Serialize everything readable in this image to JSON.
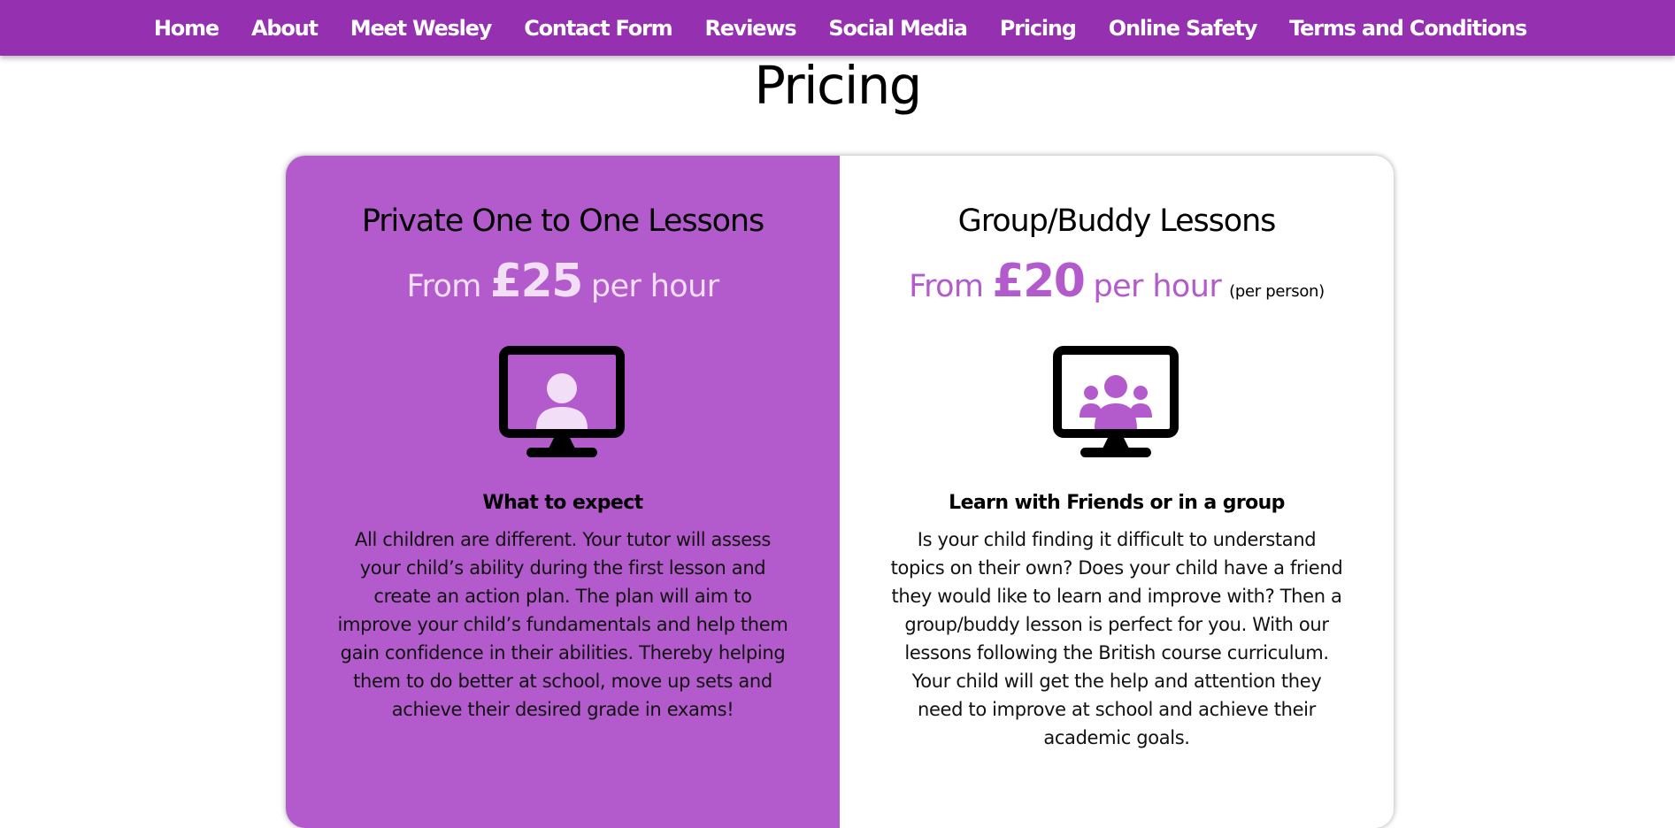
{
  "nav": {
    "items": [
      {
        "label": "Home"
      },
      {
        "label": "About"
      },
      {
        "label": "Meet Wesley"
      },
      {
        "label": "Contact Form"
      },
      {
        "label": "Reviews"
      },
      {
        "label": "Social Media"
      },
      {
        "label": "Pricing"
      },
      {
        "label": "Online Safety"
      },
      {
        "label": "Terms and Conditions"
      }
    ]
  },
  "page": {
    "title": "Pricing"
  },
  "cards": [
    {
      "title": "Private One to One Lessons",
      "price_from": "From",
      "price_amount": "£25",
      "price_per": "per hour",
      "price_note": "",
      "icon": "monitor-single-person-icon",
      "subtitle": "What to expect",
      "description": "All children are different. Your tutor will assess your child’s ability during the first lesson and create an action plan. The plan will aim to improve your child’s fundamentals and help them gain confidence in their abilities. Thereby helping them to do better at school, move up sets and achieve their desired grade in exams!"
    },
    {
      "title": "Group/Buddy Lessons",
      "price_from": "From",
      "price_amount": "£20",
      "price_per": "per hour",
      "price_note": "(per person)",
      "icon": "monitor-group-icon",
      "subtitle": "Learn with Friends or in a group",
      "description": "Is your child finding it difficult to understand topics on their own? Does your child have a friend they would like to learn and improve with? Then a group/buddy lesson is perfect for you. With our lessons following the British course curriculum. Your child will get the help and attention they need to improve at school and achieve their academic goals."
    }
  ],
  "colors": {
    "nav_background": "#9531b0",
    "accent_purple": "#b35bcc",
    "light_lilac": "#f2dff7"
  }
}
